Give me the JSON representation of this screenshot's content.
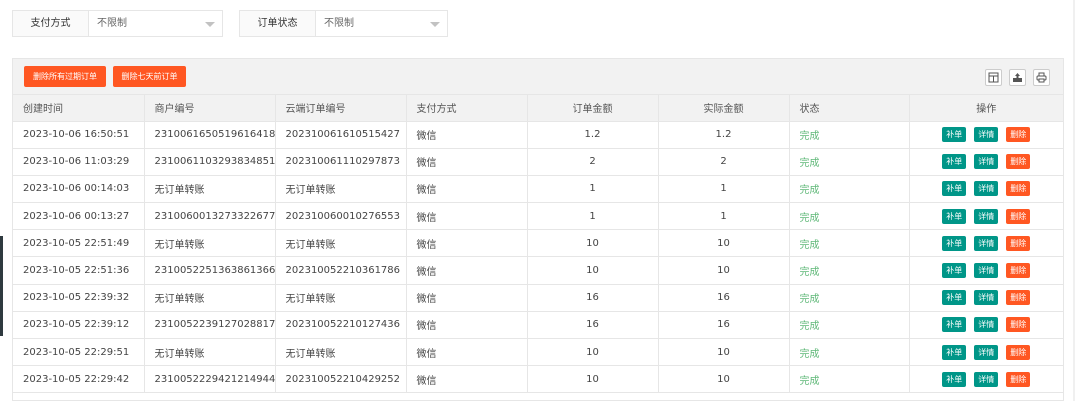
{
  "filters": {
    "pay_method": {
      "label": "支付方式",
      "value": "不限制"
    },
    "order_status": {
      "label": "订单状态",
      "value": "不限制"
    }
  },
  "toolbar": {
    "delete_expired": "删除所有过期订单",
    "delete_seven_days": "删除七天前订单",
    "icons": [
      "columns-icon",
      "export-icon",
      "print-icon"
    ]
  },
  "table": {
    "headers": [
      "创建时间",
      "商户编号",
      "云端订单编号",
      "支付方式",
      "订单金额",
      "实际金额",
      "状态",
      "操作"
    ],
    "op_labels": {
      "supplement": "补单",
      "detail": "详情",
      "delete": "删除"
    },
    "rows": [
      {
        "time": "2023-10-06 16:50:51",
        "merchant_no": "2310061650519616418",
        "cloud_no": "2023100616105154​27",
        "pay": "微信",
        "amount": "1.2",
        "actual": "1.2",
        "status": "完成"
      },
      {
        "time": "2023-10-06 11:03:29",
        "merchant_no": "2310061103293834851",
        "cloud_no": "202310061110297873",
        "pay": "微信",
        "amount": "2",
        "actual": "2",
        "status": "完成"
      },
      {
        "time": "2023-10-06 00:14:03",
        "merchant_no": "无订单转账",
        "cloud_no": "无订单转账",
        "pay": "微信",
        "amount": "1",
        "actual": "1",
        "status": "完成"
      },
      {
        "time": "2023-10-06 00:13:27",
        "merchant_no": "2310060013273322677",
        "cloud_no": "202310060010276553",
        "pay": "微信",
        "amount": "1",
        "actual": "1",
        "status": "完成"
      },
      {
        "time": "2023-10-05 22:51:49",
        "merchant_no": "无订单转账",
        "cloud_no": "无订单转账",
        "pay": "微信",
        "amount": "10",
        "actual": "10",
        "status": "完成"
      },
      {
        "time": "2023-10-05 22:51:36",
        "merchant_no": "2310052251363861366",
        "cloud_no": "202310052210361786",
        "pay": "微信",
        "amount": "10",
        "actual": "10",
        "status": "完成"
      },
      {
        "time": "2023-10-05 22:39:32",
        "merchant_no": "无订单转账",
        "cloud_no": "无订单转账",
        "pay": "微信",
        "amount": "16",
        "actual": "16",
        "status": "完成"
      },
      {
        "time": "2023-10-05 22:39:12",
        "merchant_no": "2310052239127028817",
        "cloud_no": "202310052210127436",
        "pay": "微信",
        "amount": "16",
        "actual": "16",
        "status": "完成"
      },
      {
        "time": "2023-10-05 22:29:51",
        "merchant_no": "无订单转账",
        "cloud_no": "无订单转账",
        "pay": "微信",
        "amount": "10",
        "actual": "10",
        "status": "完成"
      },
      {
        "time": "2023-10-05 22:29:42",
        "merchant_no": "2310052229421214944",
        "cloud_no": "202310052210429252",
        "pay": "微信",
        "amount": "10",
        "actual": "10",
        "status": "完成"
      }
    ]
  },
  "colors": {
    "danger": "#ff5722",
    "primary": "#009688",
    "success_text": "#5fb878"
  }
}
